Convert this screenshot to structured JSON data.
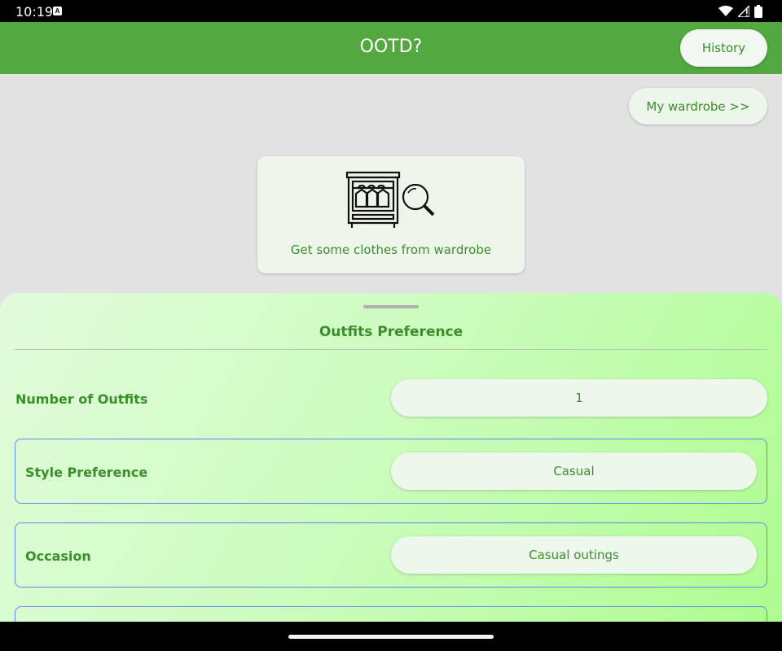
{
  "status_bar": {
    "time": "10:19",
    "notification_badge": "A"
  },
  "app_bar": {
    "title": "OOTD?",
    "history_label": "History"
  },
  "wardrobe_button": "My wardrobe >>",
  "get_card": {
    "label": "Get some clothes from wardrobe",
    "icon": "wardrobe-search-icon"
  },
  "sheet": {
    "title": "Outfits Preference",
    "rows": [
      {
        "label": "Number of Outfits",
        "value": "1"
      },
      {
        "label": "Style Preference",
        "value": "Casual"
      },
      {
        "label": "Occasion",
        "value": "Casual outings"
      }
    ]
  },
  "colors": {
    "primary": "#53a93f",
    "text_green": "#3a8f2c",
    "field_bg": "#eef7ec",
    "border_blue": "#5b8ef2"
  }
}
